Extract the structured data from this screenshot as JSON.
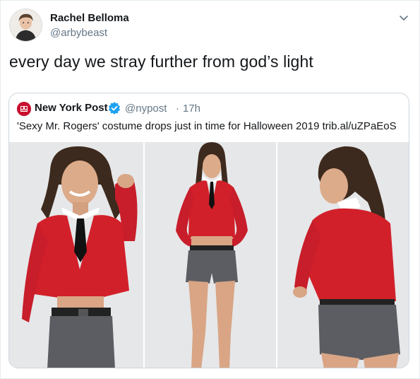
{
  "tweet": {
    "display_name": "Rachel Belloma",
    "handle": "@arbybeast",
    "text": "every day we stray further from god’s light"
  },
  "quoted_tweet": {
    "name": "New York Post",
    "handle": "@nypost",
    "separator": "·",
    "time": "17h",
    "text": "'Sexy Mr. Rogers' costume drops just in time for Halloween 2019 trib.al/uZPaEoS",
    "media": [
      {
        "icon": "photo-model-closeup"
      },
      {
        "icon": "photo-model-full-body"
      },
      {
        "icon": "photo-model-back-view"
      }
    ]
  },
  "colors": {
    "text": "#14171a",
    "secondary": "#657786",
    "border": "#ccd6dd",
    "verified": "#1da1f2",
    "cardigan": "#d2202a",
    "shorts": "#5b5d62",
    "nypost": "#c8102e"
  }
}
